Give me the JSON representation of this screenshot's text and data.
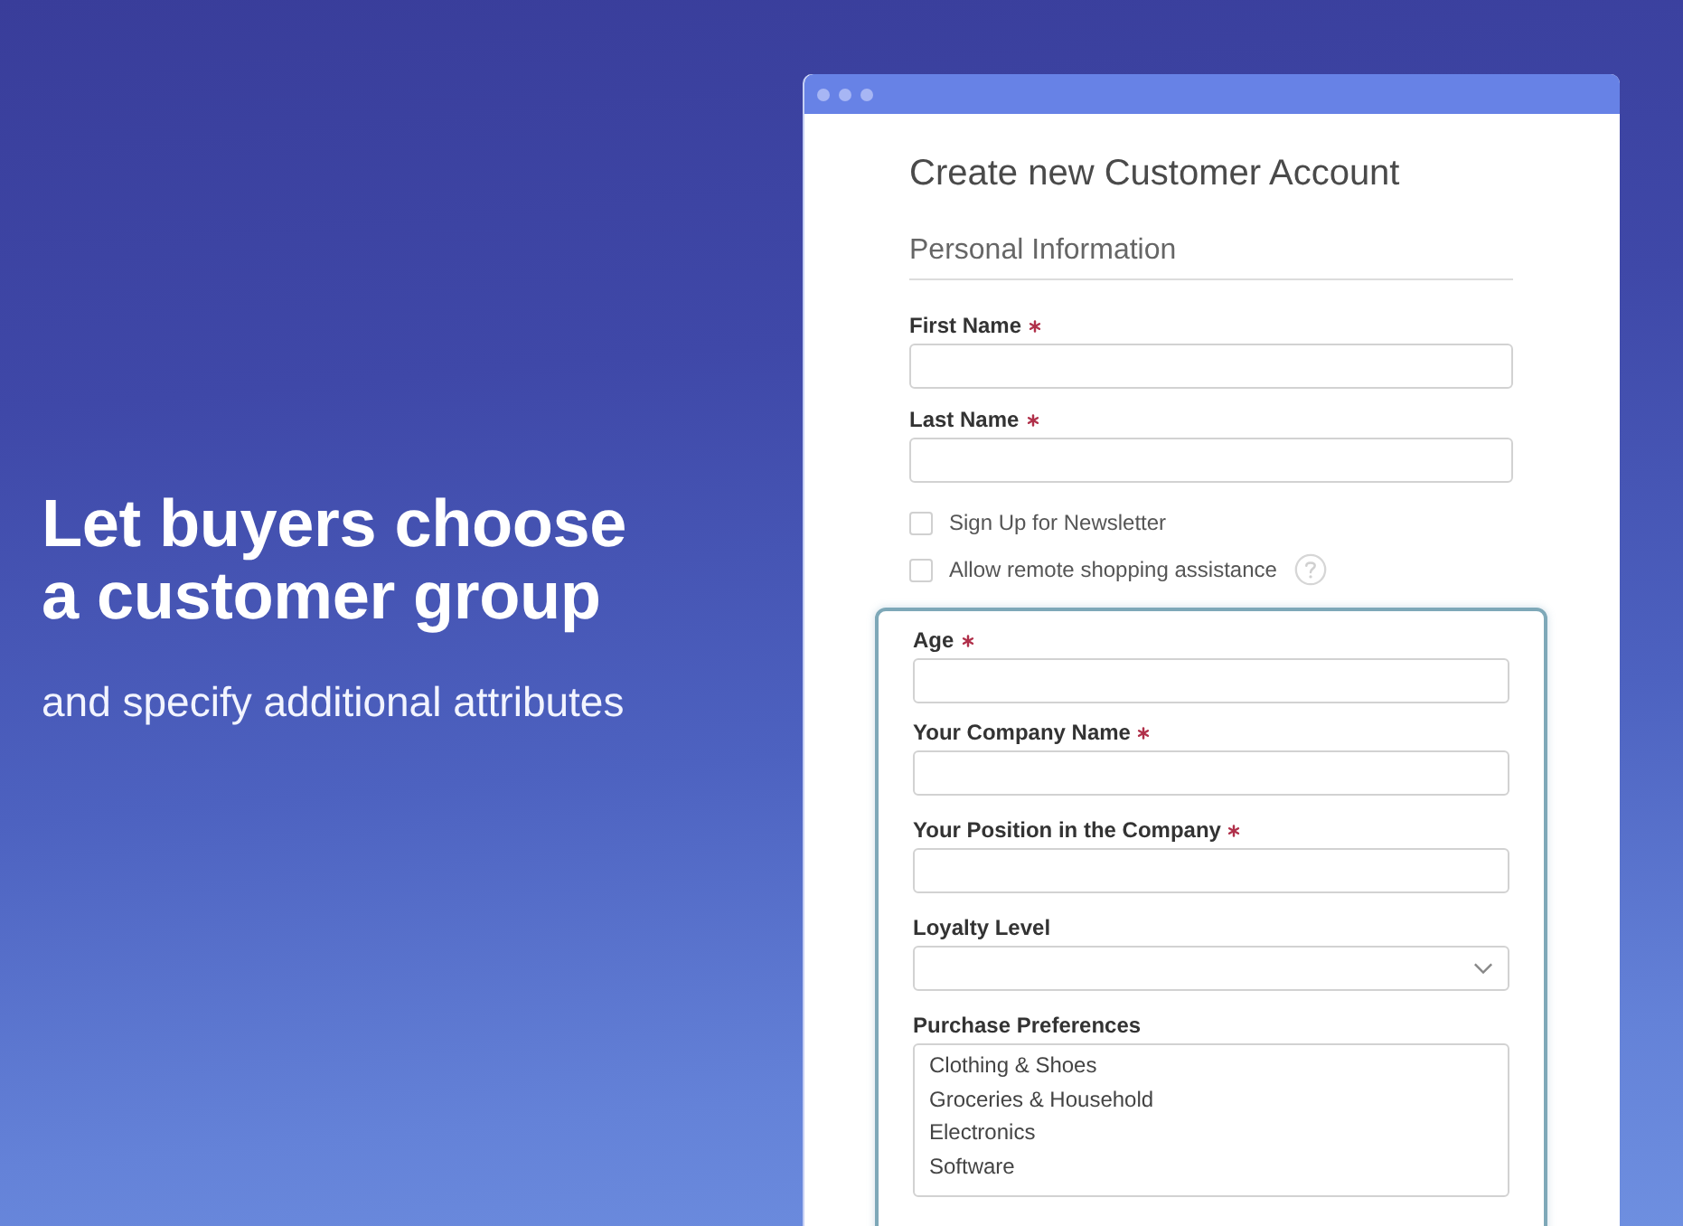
{
  "hero": {
    "headline": "Let buyers choose\na customer group",
    "subtitle": "and specify additional attributes"
  },
  "window": {
    "title": "Create new Customer Account",
    "section": "Personal Information",
    "fields": [
      {
        "kind": "text",
        "label": "First Name",
        "required": true
      },
      {
        "kind": "text",
        "label": "Last Name",
        "required": true
      }
    ],
    "checkboxes": [
      {
        "label": "Sign Up for Newsletter",
        "checked": false,
        "help": false
      },
      {
        "label": "Allow remote shopping assistance",
        "checked": false,
        "help": true
      }
    ],
    "attributes": {
      "highlighted": true,
      "fields": [
        {
          "kind": "text",
          "label": "Age",
          "required": true
        },
        {
          "kind": "text",
          "label": "Your Company Name",
          "required": true
        },
        {
          "kind": "text",
          "label": "Your Position in the Company",
          "required": true
        },
        {
          "kind": "select",
          "label": "Loyalty Level",
          "required": false
        },
        {
          "kind": "listbox",
          "label": "Purchase Preferences",
          "required": false,
          "options": [
            {
              "label": "Clothing & Shoes",
              "selected": false
            },
            {
              "label": "Groceries & Household",
              "selected": false
            },
            {
              "label": "Electronics",
              "selected": false
            },
            {
              "label": "Software",
              "selected": false
            }
          ]
        }
      ]
    }
  }
}
